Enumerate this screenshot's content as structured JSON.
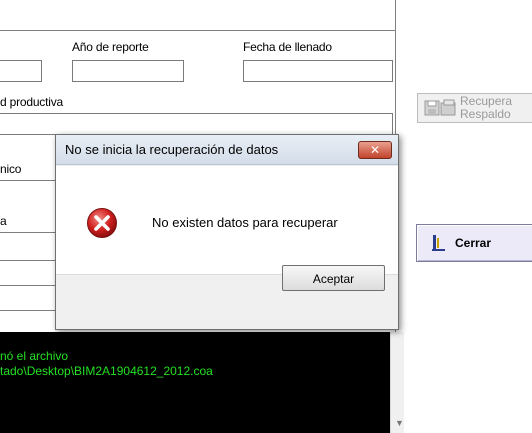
{
  "form": {
    "label_year": "Año de reporte",
    "label_date": "Fecha de llenado",
    "label_productive": "d productiva",
    "label_nico": "nico",
    "label_a": "a"
  },
  "buttons": {
    "recover_line1": "Recupera",
    "recover_line2": "Respaldo",
    "close": "Cerrar"
  },
  "console": {
    "line1": "nó el archivo",
    "line2": "tado\\Desktop\\BIM2A1904612_2012.coa"
  },
  "dialog": {
    "title": "No se inicia la recuperación de datos",
    "close_glyph": "✕",
    "message": "No existen datos para recuperar",
    "ok_label": "Aceptar"
  },
  "icons": {
    "error": "error-icon",
    "disk": "floppy-disk-icon",
    "door": "exit-door-icon"
  },
  "colors": {
    "console_text": "#22e022",
    "error_red": "#d0201f",
    "close_button_bg": "#ece9f8"
  }
}
